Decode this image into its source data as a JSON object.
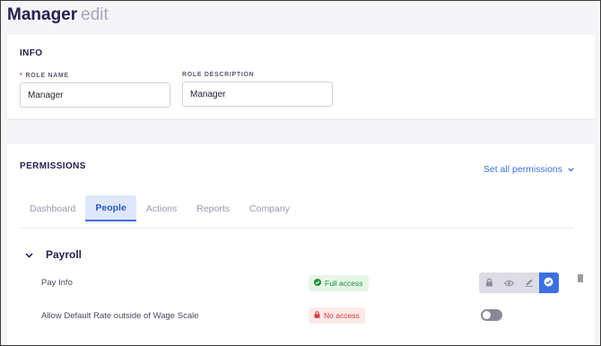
{
  "header": {
    "title": "Manager",
    "subtitle": "edit"
  },
  "info": {
    "section_title": "INFO",
    "role_name": {
      "label": "ROLE NAME",
      "required_mark": "*",
      "value": "Manager"
    },
    "role_description": {
      "label": "ROLE DESCRIPTION",
      "value": "Manager"
    }
  },
  "permissions": {
    "section_title": "PERMISSIONS",
    "set_all_label": "Set all permissions",
    "tabs": [
      {
        "label": "Dashboard",
        "active": false
      },
      {
        "label": "People",
        "active": true
      },
      {
        "label": "Actions",
        "active": false
      },
      {
        "label": "Reports",
        "active": false
      },
      {
        "label": "Company",
        "active": false
      }
    ],
    "group": {
      "title": "Payroll",
      "expanded": true,
      "items": [
        {
          "label": "Pay Info",
          "status": "Full access",
          "control": "segmented",
          "selected": "full-access"
        },
        {
          "label": "Allow Default Rate outside of Wage Scale",
          "status": "No access",
          "control": "toggle",
          "enabled": false
        }
      ]
    },
    "segment_icons": [
      "lock-icon",
      "eye-icon",
      "pencil-icon",
      "check-circle-icon"
    ]
  },
  "colors": {
    "accent": "#3d6fe0",
    "full_access": "#1f8f3b",
    "no_access": "#d13b3b",
    "title": "#25204f"
  }
}
